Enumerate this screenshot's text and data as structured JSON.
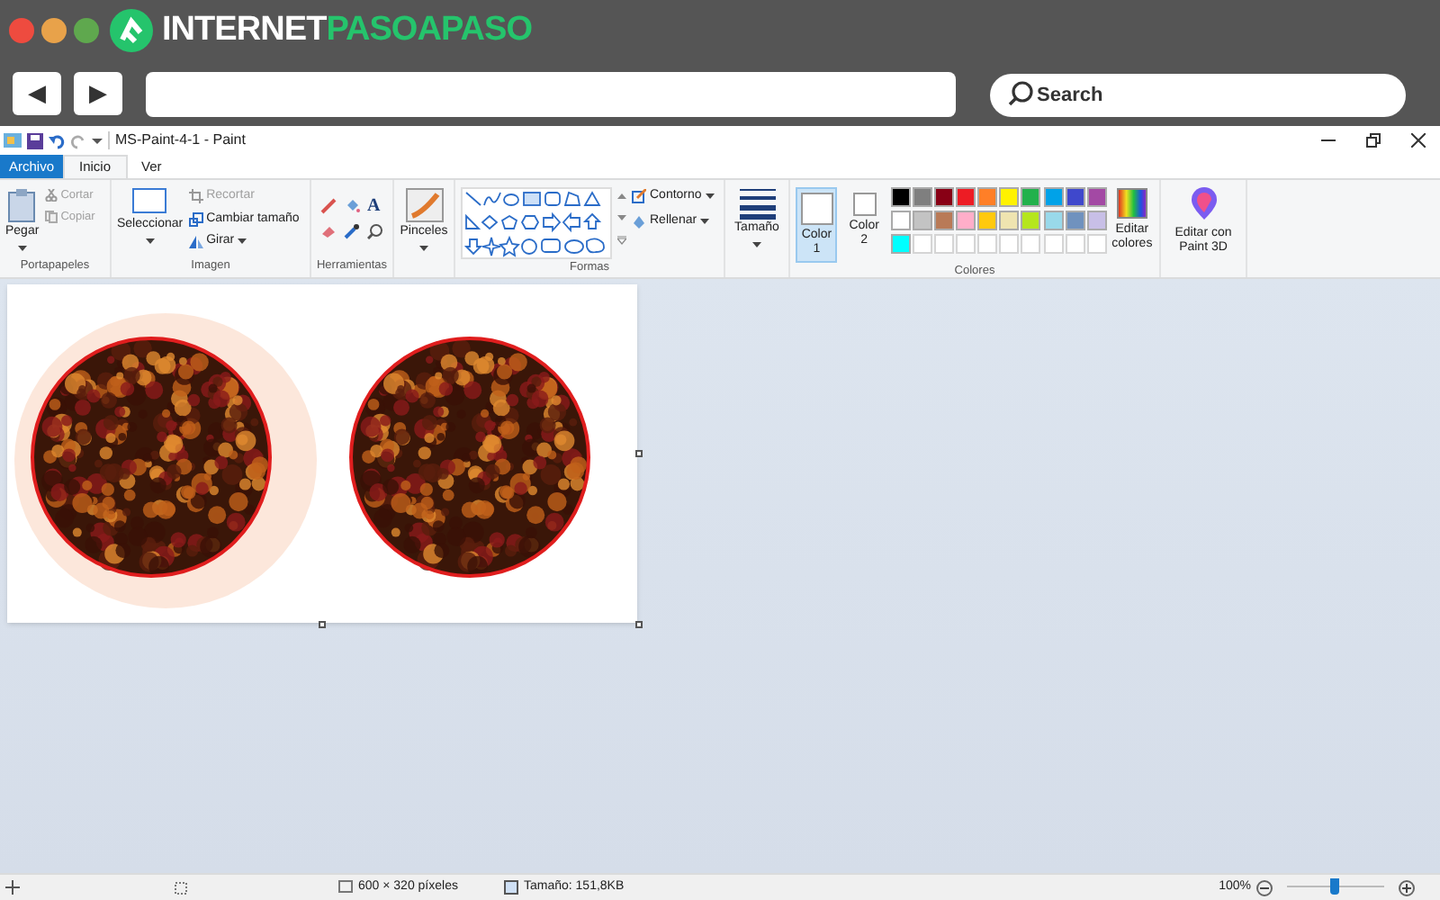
{
  "site_header": {
    "logo_text_1": "INTERNET",
    "logo_text_2": "PASOAPASO",
    "back_button": "◀",
    "forward_button": "▶",
    "search": {
      "placeholder": "Search"
    }
  },
  "window": {
    "title": "MS-Paint-4-1 - Paint"
  },
  "tabs": [
    {
      "label": "Archivo",
      "kind": "file",
      "selected": false
    },
    {
      "label": "Inicio",
      "kind": "tab",
      "selected": true
    },
    {
      "label": "Ver",
      "kind": "tab",
      "selected": false
    }
  ],
  "ribbon": {
    "clipboard": {
      "paste": "Pegar",
      "cut": "Cortar",
      "copy": "Copiar",
      "group": "Portapapeles",
      "cut_disabled": true,
      "copy_disabled": true
    },
    "image": {
      "select": "Seleccionar",
      "crop": "Recortar",
      "resize": "Cambiar tamaño",
      "rotate": "Girar",
      "group": "Imagen",
      "crop_disabled": true
    },
    "tools": {
      "group": "Herramientas",
      "text_tool": "A"
    },
    "brushes": "Pinceles",
    "shapes": {
      "outline": "Contorno",
      "fill": "Rellenar",
      "group": "Formas"
    },
    "size": "Tamaño",
    "colors": {
      "color1": {
        "label": "Color 1",
        "selected": true
      },
      "color2": {
        "label": "Color 2",
        "selected": false
      },
      "palette": [
        {
          "color": "#000000"
        },
        {
          "color": "#7f7f7f"
        },
        {
          "color": "#880015"
        },
        {
          "color": "#ed1c24"
        },
        {
          "color": "#ff7f27"
        },
        {
          "color": "#fff200"
        },
        {
          "color": "#22b14c"
        },
        {
          "color": "#00a2e8"
        },
        {
          "color": "#3f48cc"
        },
        {
          "color": "#a349a4"
        },
        {
          "color": "#ffffff"
        },
        {
          "color": "#c3c3c3"
        },
        {
          "color": "#b97a57"
        },
        {
          "color": "#ffaec9"
        },
        {
          "color": "#ffc90e"
        },
        {
          "color": "#efe4b0"
        },
        {
          "color": "#b5e61d"
        },
        {
          "color": "#99d9ea"
        },
        {
          "color": "#7092be"
        },
        {
          "color": "#c8bfe7"
        },
        {
          "color": "#00ffff"
        },
        {
          "kind": "empty"
        },
        {
          "kind": "empty"
        },
        {
          "kind": "empty"
        },
        {
          "kind": "empty"
        },
        {
          "kind": "empty"
        },
        {
          "kind": "empty"
        },
        {
          "kind": "empty"
        },
        {
          "kind": "empty"
        },
        {
          "kind": "empty"
        }
      ],
      "edit_colors": "Editar colores",
      "group": "Colores"
    },
    "paint3d": "Editar con Paint 3D"
  },
  "status_bar": {
    "dimensions": "600 × 320 píxeles",
    "file_size": "Tamaño: 151,8KB",
    "zoom": "100%",
    "zoom_slider": {
      "level": 0.5
    }
  }
}
